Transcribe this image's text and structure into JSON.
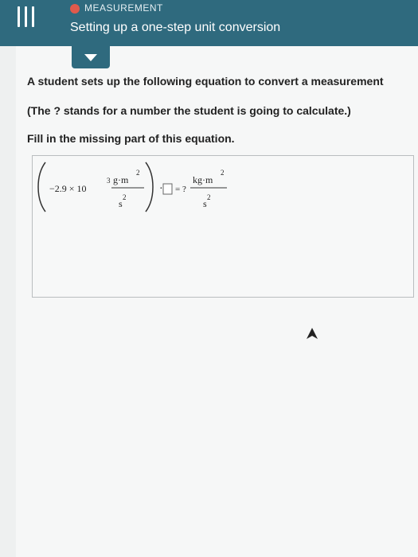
{
  "header": {
    "topic_label": "MEASUREMENT",
    "title": "Setting up a one-step unit conversion"
  },
  "question": {
    "line1": "A student sets up the following equation to convert a measurement",
    "line2": "(The ? stands for a number the student is going to calculate.)",
    "line3": "Fill in the missing part of this equation."
  },
  "equation": {
    "coefficient": "−2.9 × 10",
    "exponent": "3",
    "left_num_unit": "g·m",
    "left_num_exp": "2",
    "left_den_unit": "s",
    "left_den_exp": "2",
    "dot": "·",
    "equals": "= ?",
    "right_num_unit": "kg·m",
    "right_num_exp": "2",
    "right_den_unit": "s",
    "right_den_exp": "2"
  },
  "colors": {
    "header_bg": "#2f6a7e",
    "topic_dot": "#e05a4c"
  }
}
